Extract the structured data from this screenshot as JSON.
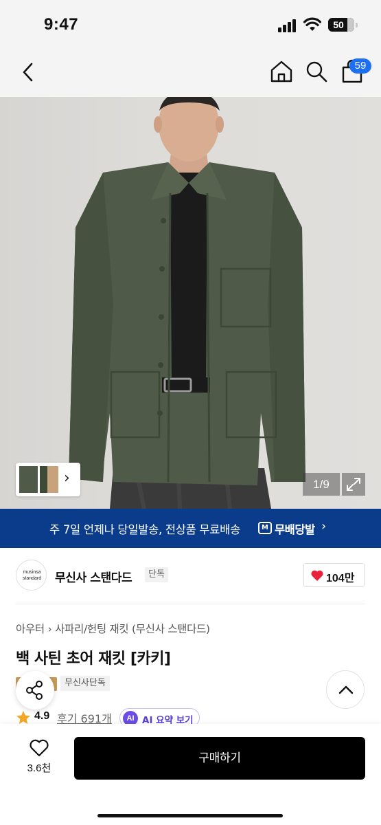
{
  "status_bar": {
    "time": "9:47",
    "battery": "50"
  },
  "nav": {
    "cart_count": "59"
  },
  "gallery": {
    "counter": "1/9"
  },
  "banner": {
    "text": "주 7일 언제나 당일발송, 전상품 무료배송",
    "brand": "무배당발",
    "logo_letter": "M"
  },
  "brand": {
    "logo_line1": "musinsa",
    "logo_line2": "standard",
    "name": "무신사 스탠다드",
    "tag": "단독",
    "likes": "104만"
  },
  "breadcrumb": {
    "category": "아우터",
    "subcategory": "사파리/헌팅 재킷 (무신사 스탠다드)"
  },
  "product": {
    "title": "백 사틴 초어 재킷 [카키]",
    "exclusive_badge": "무신사단독",
    "rating": "4.9",
    "reviews": "후기 691개",
    "ai_summary": "AI 요약 보기",
    "ai_icon": "AI"
  },
  "bottom_bar": {
    "wish_count": "3.6천",
    "buy_label": "구매하기"
  },
  "colors": {
    "accent_blue": "#1d6ff2",
    "banner_navy": "#0b3c8c",
    "heart_red": "#e8203a",
    "ai_purple": "#6b4ce6"
  }
}
